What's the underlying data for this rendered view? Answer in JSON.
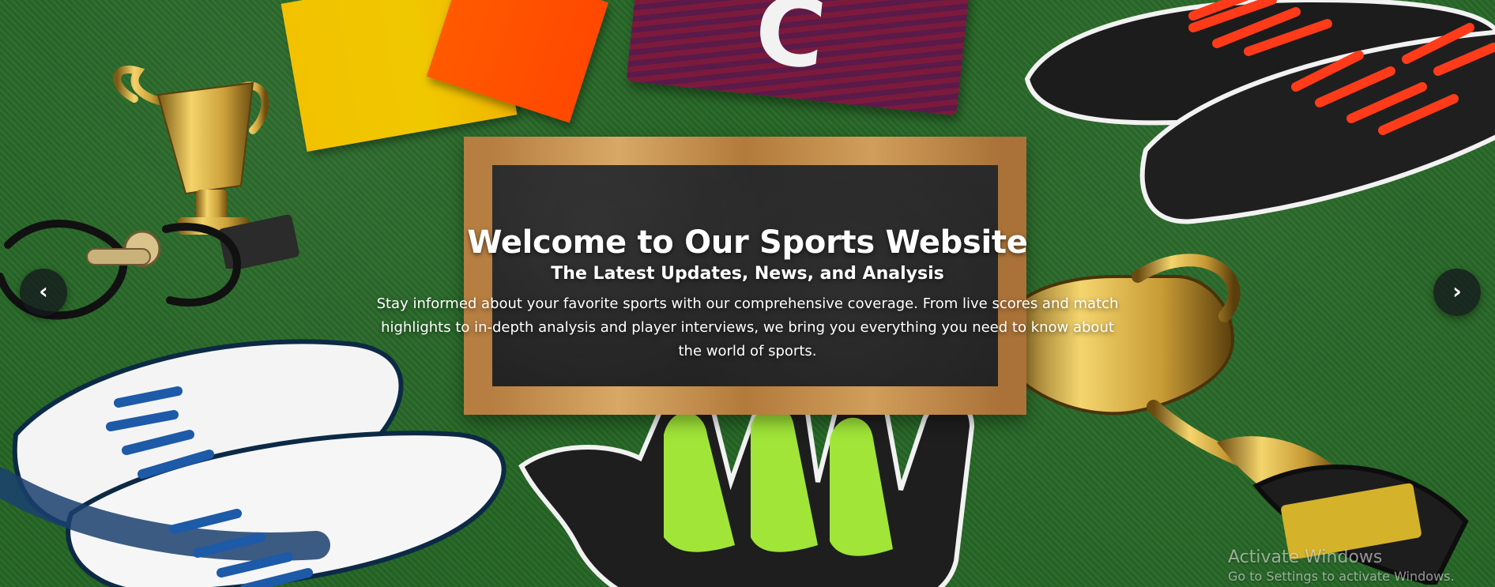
{
  "hero": {
    "title": "Welcome to Our Sports Website",
    "subtitle": "The Latest Updates, News, and Analysis",
    "description": "Stay informed about your favorite sports with our comprehensive coverage. From live scores and match highlights to in-depth analysis and player interviews, we bring you everything you need to know about the world of sports.",
    "armband_letter": "C"
  },
  "carousel": {
    "prev_symbol": "‹",
    "next_symbol": "›",
    "prev_icon": "chevron-left-icon",
    "next_icon": "chevron-right-icon"
  },
  "os_watermark": {
    "title": "Activate Windows",
    "subtitle": "Go to Settings to activate Windows."
  },
  "colors": {
    "grass": "#2a6b2a",
    "chalkboard": "#262626",
    "frame": "#b27a3b",
    "button_bg": "#14181e",
    "text": "#ffffff"
  }
}
